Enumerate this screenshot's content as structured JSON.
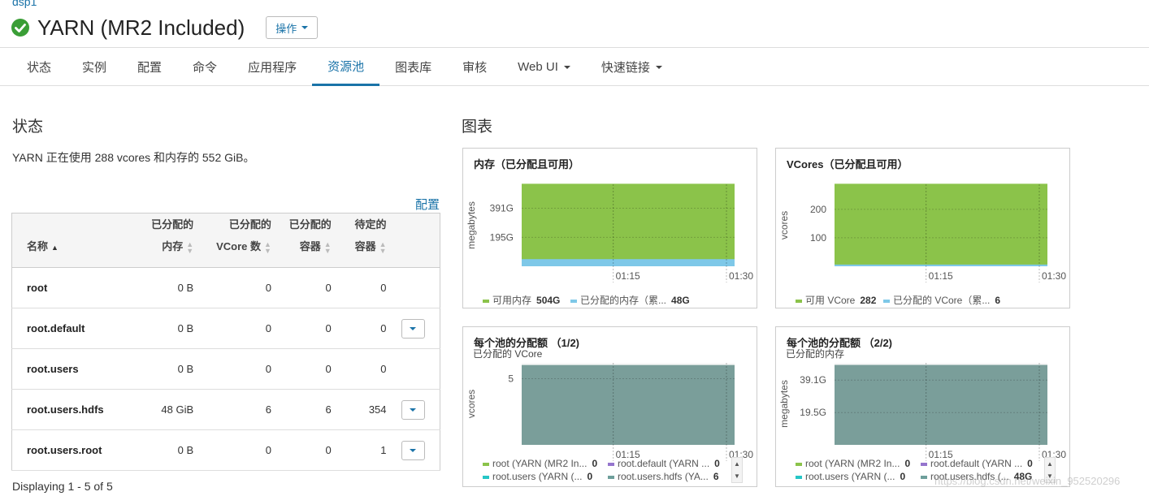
{
  "breadcrumb": "dsp1",
  "service": {
    "title": "YARN (MR2 Included)",
    "action_label": "操作",
    "status_color": "#3a9e36"
  },
  "tabs": [
    {
      "label": "状态",
      "active": false,
      "dropdown": false
    },
    {
      "label": "实例",
      "active": false,
      "dropdown": false
    },
    {
      "label": "配置",
      "active": false,
      "dropdown": false
    },
    {
      "label": "命令",
      "active": false,
      "dropdown": false
    },
    {
      "label": "应用程序",
      "active": false,
      "dropdown": false
    },
    {
      "label": "资源池",
      "active": true,
      "dropdown": false
    },
    {
      "label": "图表库",
      "active": false,
      "dropdown": false
    },
    {
      "label": "审核",
      "active": false,
      "dropdown": false
    },
    {
      "label": "Web UI",
      "active": false,
      "dropdown": true
    },
    {
      "label": "快速链接",
      "active": false,
      "dropdown": true
    }
  ],
  "status": {
    "heading": "状态",
    "usage_text": "YARN 正在使用 288 vcores 和内存的 552 GiB。",
    "config_link": "配置",
    "table": {
      "headers": [
        {
          "lines": [
            "名称"
          ],
          "sort": "asc"
        },
        {
          "lines": [
            "已分配的",
            "内存"
          ],
          "sort": "none"
        },
        {
          "lines": [
            "已分配的",
            "VCore 数"
          ],
          "sort": "none"
        },
        {
          "lines": [
            "已分配的",
            "容器"
          ],
          "sort": "none"
        },
        {
          "lines": [
            "待定的",
            "容器"
          ],
          "sort": "none"
        }
      ],
      "rows": [
        {
          "name": "root",
          "memory": "0 B",
          "vcores": "0",
          "containers": "0",
          "pending": "0",
          "menu": false
        },
        {
          "name": "root.default",
          "memory": "0 B",
          "vcores": "0",
          "containers": "0",
          "pending": "0",
          "menu": true
        },
        {
          "name": "root.users",
          "memory": "0 B",
          "vcores": "0",
          "containers": "0",
          "pending": "0",
          "menu": false
        },
        {
          "name": "root.users.hdfs",
          "memory": "48 GiB",
          "vcores": "6",
          "containers": "6",
          "pending": "354",
          "menu": true
        },
        {
          "name": "root.users.root",
          "memory": "0 B",
          "vcores": "0",
          "containers": "0",
          "pending": "1",
          "menu": true
        }
      ]
    },
    "displaying": "Displaying 1 - 5 of 5"
  },
  "charts_heading": "图表",
  "cards": [
    {
      "title": "内存（已分配且可用）",
      "subtitle": "",
      "legend": [
        {
          "label": "可用内存",
          "value": "504G",
          "color": "#8bc34a"
        },
        {
          "label": "已分配的内存（累...",
          "value": "48G",
          "color": "#7ec8e8"
        }
      ],
      "pager": false
    },
    {
      "title": "VCores（已分配且可用）",
      "subtitle": "",
      "legend": [
        {
          "label": "可用 VCore",
          "value": "282",
          "color": "#8bc34a"
        },
        {
          "label": "已分配的 VCore（累...",
          "value": "6",
          "color": "#7ec8e8"
        }
      ],
      "pager": false
    },
    {
      "title": "每个池的分配额 （1/2)",
      "subtitle": "已分配的 VCore",
      "legend": [
        {
          "label": "root (YARN (MR2 In...",
          "value": "0",
          "color": "#8bc34a"
        },
        {
          "label": "root.default (YARN ...",
          "value": "0",
          "color": "#9575cd"
        },
        {
          "label": "root.users (YARN (...",
          "value": "0",
          "color": "#26c6c6"
        },
        {
          "label": "root.users.hdfs (YA...",
          "value": "6",
          "color": "#6e9f9b"
        }
      ],
      "pager": true
    },
    {
      "title": "每个池的分配额 （2/2)",
      "subtitle": "已分配的内存",
      "legend": [
        {
          "label": "root (YARN (MR2 In...",
          "value": "0",
          "color": "#8bc34a"
        },
        {
          "label": "root.default (YARN ...",
          "value": "0",
          "color": "#9575cd"
        },
        {
          "label": "root.users (YARN (...",
          "value": "0",
          "color": "#26c6c6"
        },
        {
          "label": "root.users.hdfs (...",
          "value": "48G",
          "color": "#6e9f9b"
        }
      ],
      "pager": true
    }
  ],
  "chart_data": [
    {
      "type": "area",
      "title": "内存（已分配且可用）",
      "ylabel": "megabytes",
      "x_ticks": [
        "01:15",
        "01:30"
      ],
      "y_ticks": [
        {
          "label": "195G",
          "value": 195
        },
        {
          "label": "391G",
          "value": 391
        }
      ],
      "ylim": [
        0,
        552
      ],
      "series": [
        {
          "name": "已分配的内存（累...",
          "value": 48,
          "color": "#7ec8e8"
        },
        {
          "name": "可用内存",
          "value": 504,
          "color": "#8bc34a"
        }
      ]
    },
    {
      "type": "area",
      "title": "VCores（已分配且可用）",
      "ylabel": "vcores",
      "x_ticks": [
        "01:15",
        "01:30"
      ],
      "y_ticks": [
        {
          "label": "100",
          "value": 100
        },
        {
          "label": "200",
          "value": 200
        }
      ],
      "ylim": [
        0,
        288
      ],
      "series": [
        {
          "name": "已分配的 VCore（累...",
          "value": 6,
          "color": "#7ec8e8"
        },
        {
          "name": "可用 VCore",
          "value": 282,
          "color": "#8bc34a"
        }
      ]
    },
    {
      "type": "area",
      "title": "每个池的分配额 （1/2)",
      "ylabel": "vcores",
      "x_ticks": [
        "01:15",
        "01:30"
      ],
      "y_ticks": [
        {
          "label": "5",
          "value": 5
        }
      ],
      "ylim": [
        0,
        6.2
      ],
      "series": [
        {
          "name": "root.users.hdfs (YA...",
          "value": 6,
          "color": "#7a9e9a"
        }
      ]
    },
    {
      "type": "area",
      "title": "每个池的分配额 （2/2)",
      "ylabel": "megabytes",
      "x_ticks": [
        "01:15",
        "01:30"
      ],
      "y_ticks": [
        {
          "label": "19.5G",
          "value": 19.5
        },
        {
          "label": "39.1G",
          "value": 39.1
        }
      ],
      "ylim": [
        0,
        49.5
      ],
      "series": [
        {
          "name": "root.users.hdfs (...",
          "value": 48,
          "color": "#7a9e9a"
        }
      ]
    }
  ],
  "watermark": "https://blog.csdn.net/weixin_952520296"
}
